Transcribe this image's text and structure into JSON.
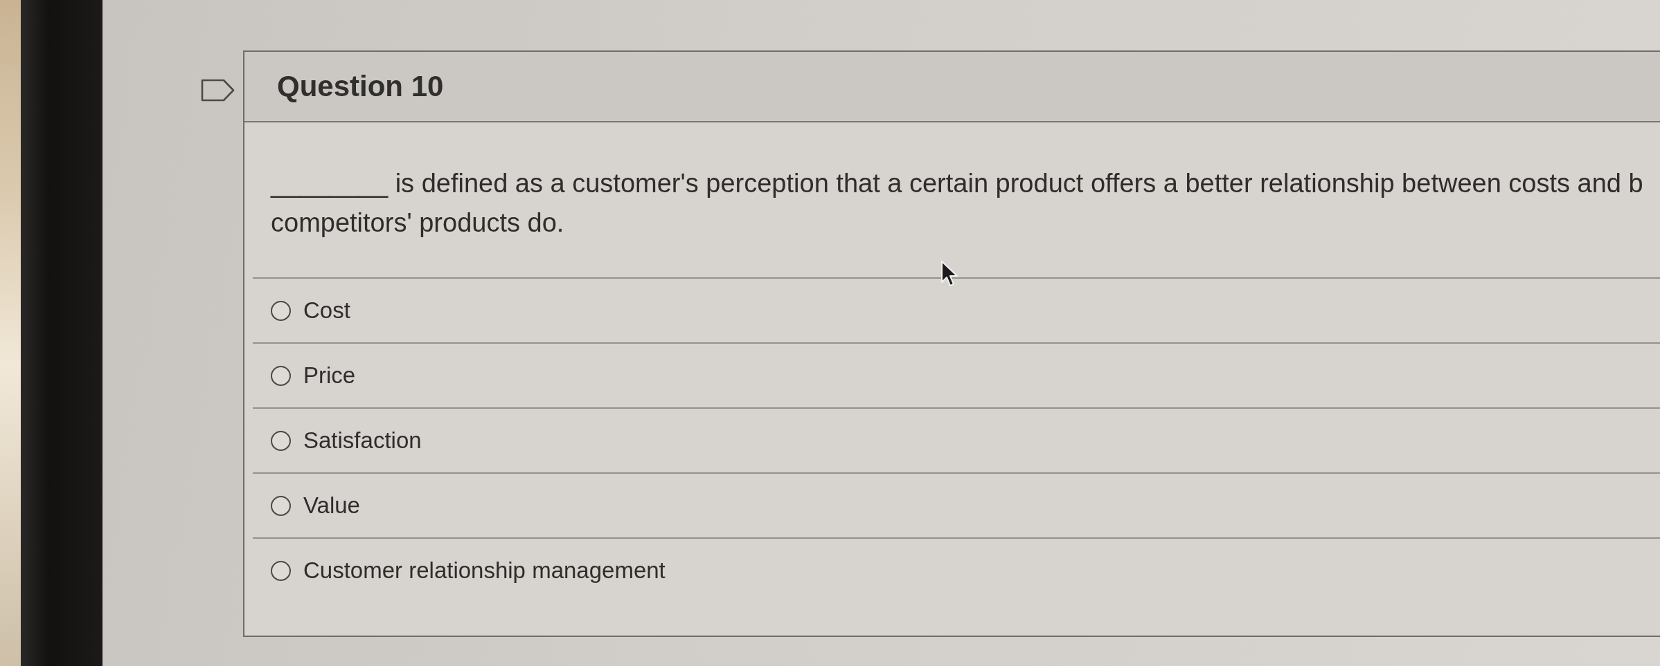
{
  "question": {
    "title": "Question 10",
    "prompt_lines": [
      "________ is defined as a customer's perception that a certain product offers a better relationship between costs and b",
      "competitors' products do."
    ],
    "options": [
      {
        "label": "Cost",
        "selected": false
      },
      {
        "label": "Price",
        "selected": false
      },
      {
        "label": "Satisfaction",
        "selected": false
      },
      {
        "label": "Value",
        "selected": false
      },
      {
        "label": "Customer relationship management",
        "selected": false
      }
    ]
  }
}
